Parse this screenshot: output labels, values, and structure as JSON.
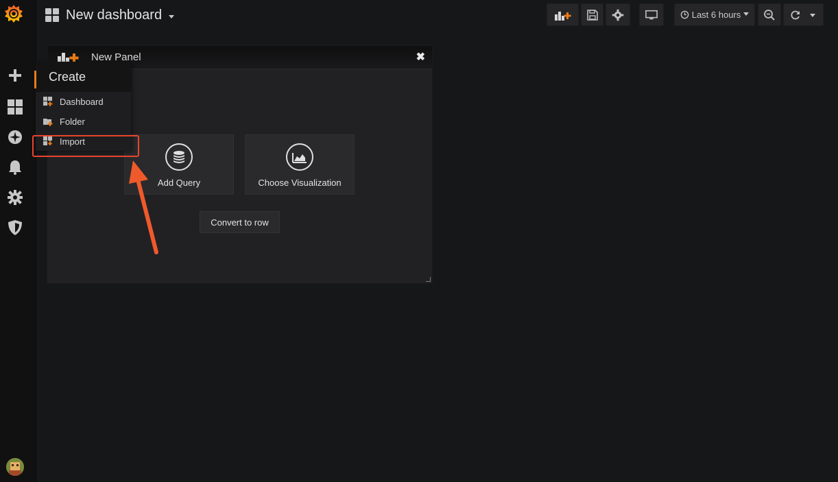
{
  "header": {
    "dashboard_title": "New dashboard",
    "time_range": "Last 6 hours"
  },
  "sidebar": {
    "items": [
      {
        "icon": "grafana-logo-icon"
      },
      {
        "icon": "plus-icon"
      },
      {
        "icon": "dashboards-icon"
      },
      {
        "icon": "explore-icon"
      },
      {
        "icon": "bell-icon"
      },
      {
        "icon": "gear-icon"
      },
      {
        "icon": "shield-icon"
      }
    ]
  },
  "create_menu": {
    "title": "Create",
    "items": [
      {
        "label": "Dashboard"
      },
      {
        "label": "Folder"
      },
      {
        "label": "Import"
      }
    ]
  },
  "panel": {
    "title": "New Panel",
    "add_query_label": "Add Query",
    "choose_viz_label": "Choose Visualization",
    "convert_label": "Convert to row"
  },
  "colors": {
    "accent_orange": "#eb7b18",
    "annotation_red": "#e8452c",
    "background": "#161719",
    "sidebar": "#111111"
  }
}
